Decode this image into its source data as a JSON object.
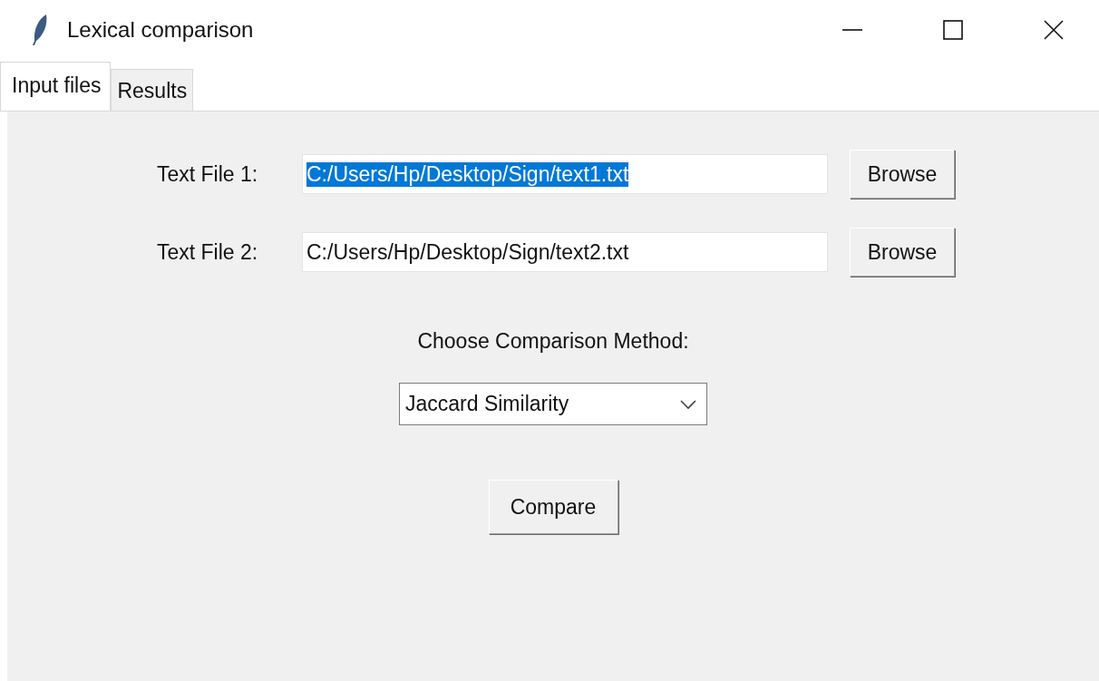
{
  "window": {
    "title": "Lexical comparison"
  },
  "tabs": [
    {
      "label": "Input files",
      "selected": true
    },
    {
      "label": "Results",
      "selected": false
    }
  ],
  "file_rows": [
    {
      "label": "Text File 1:",
      "value": "C:/Users/Hp/Desktop/Sign/text1.txt",
      "text_selected": true,
      "button": "Browse"
    },
    {
      "label": "Text File 2:",
      "value": "C:/Users/Hp/Desktop/Sign/text2.txt",
      "text_selected": false,
      "button": "Browse"
    }
  ],
  "method": {
    "label": "Choose Comparison Method:",
    "value": "Jaccard Similarity"
  },
  "compare_button": "Compare"
}
